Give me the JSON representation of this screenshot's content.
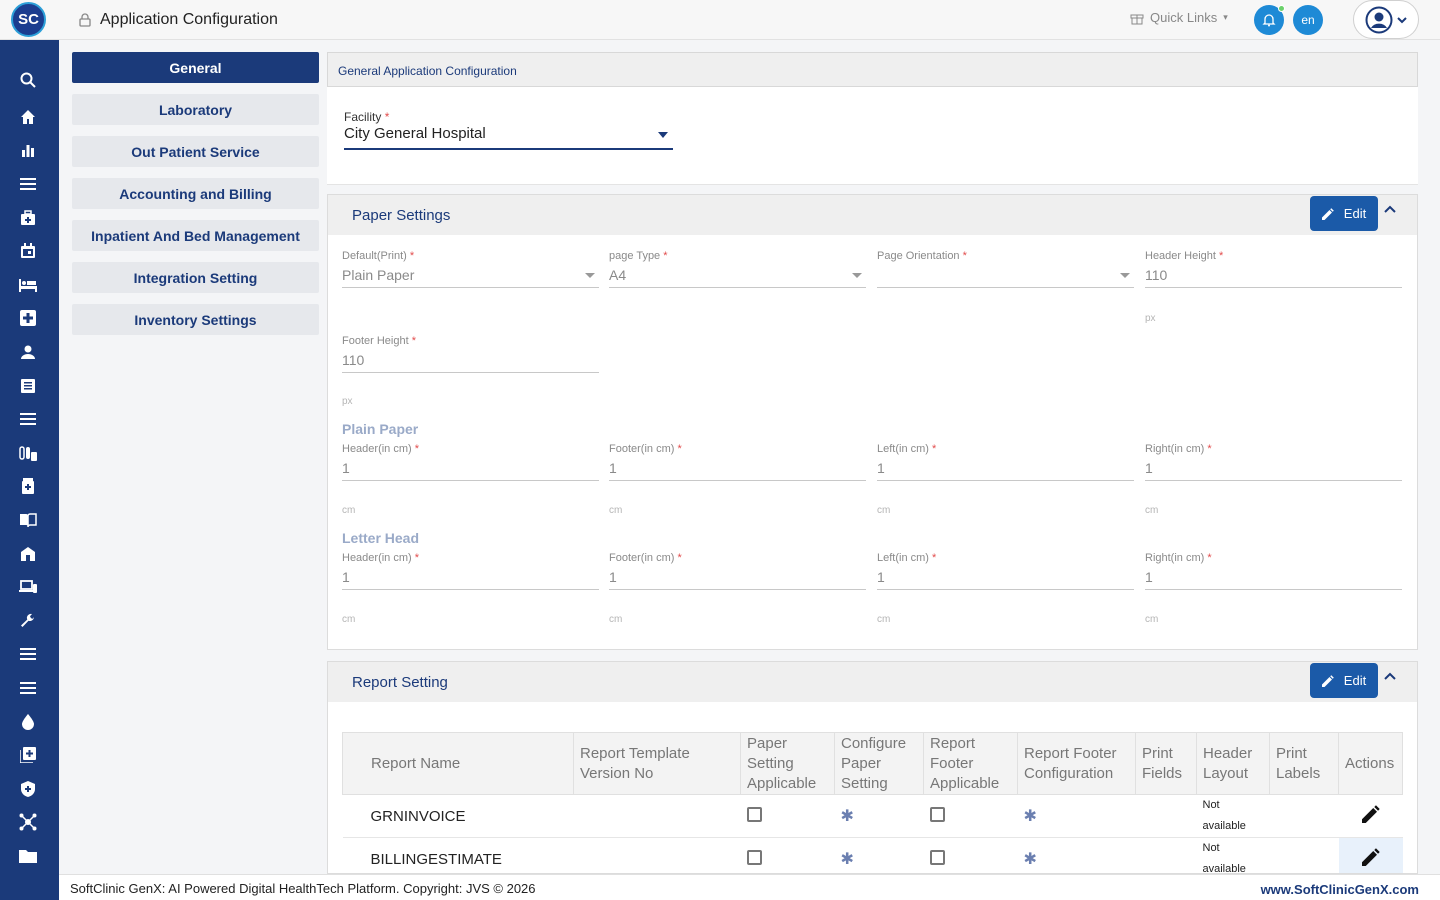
{
  "app": {
    "logo_text": "SC",
    "title": "Application Configuration",
    "quick_links": "Quick Links",
    "lang": "en"
  },
  "left_nav": [
    {
      "label": "General",
      "active": true
    },
    {
      "label": "Laboratory"
    },
    {
      "label": "Out Patient Service"
    },
    {
      "label": "Accounting and Billing"
    },
    {
      "label": "Inpatient And Bed Management"
    },
    {
      "label": "Integration Setting"
    },
    {
      "label": "Inventory Settings"
    }
  ],
  "main": {
    "header": "General Application Configuration",
    "facility": {
      "label": "Facility",
      "required": "*",
      "value": "City General Hospital"
    }
  },
  "paper_settings": {
    "title": "Paper Settings",
    "edit_label": "Edit",
    "default_print": {
      "label": "Default(Print)",
      "value": "Plain Paper"
    },
    "page_type": {
      "label": "page Type",
      "value": "A4"
    },
    "page_orientation": {
      "label": "Page Orientation",
      "value": ""
    },
    "header_height": {
      "label": "Header Height",
      "value": "110",
      "unit": "px"
    },
    "footer_height": {
      "label": "Footer Height",
      "value": "110",
      "unit": "px"
    },
    "plain_paper": {
      "title": "Plain Paper",
      "header": {
        "label": "Header(in cm)",
        "value": "1",
        "unit": "cm"
      },
      "footer": {
        "label": "Footer(in cm)",
        "value": "1",
        "unit": "cm"
      },
      "left": {
        "label": "Left(in cm)",
        "value": "1",
        "unit": "cm"
      },
      "right": {
        "label": "Right(in cm)",
        "value": "1",
        "unit": "cm"
      }
    },
    "letter_head": {
      "title": "Letter Head",
      "header": {
        "label": "Header(in cm)",
        "value": "1",
        "unit": "cm"
      },
      "footer": {
        "label": "Footer(in cm)",
        "value": "1",
        "unit": "cm"
      },
      "left": {
        "label": "Left(in cm)",
        "value": "1",
        "unit": "cm"
      },
      "right": {
        "label": "Right(in cm)",
        "value": "1",
        "unit": "cm"
      }
    }
  },
  "report_setting": {
    "title": "Report Setting",
    "edit_label": "Edit",
    "columns": {
      "report_name": "Report Name",
      "template_version_1": "Report Template",
      "template_version_2": "Version No",
      "paper_setting_1": "Paper",
      "paper_setting_2": "Setting",
      "paper_setting_3": "Applicable",
      "configure_paper_1": "Configure",
      "configure_paper_2": "Paper",
      "configure_paper_3": "Setting",
      "report_footer_1": "Report",
      "report_footer_2": "Footer",
      "report_footer_3": "Applicable",
      "footer_config_1": "Report Footer",
      "footer_config_2": "Configuration",
      "print_fields_1": "Print",
      "print_fields_2": "Fields",
      "header_layout_1": "Header",
      "header_layout_2": "Layout",
      "print_labels_1": "Print",
      "print_labels_2": "Labels",
      "actions": "Actions"
    },
    "rows": [
      {
        "name": "GRNINVOICE",
        "header_layout_1": "Not",
        "header_layout_2": "available"
      },
      {
        "name": "BILLINGESTIMATE",
        "header_layout_1": "Not",
        "header_layout_2": "available"
      }
    ]
  },
  "footer": {
    "copyright": "SoftClinic GenX: AI Powered Digital HealthTech Platform. Copyright: JVS © 2026",
    "website": "www.SoftClinicGenX.com"
  },
  "colors": {
    "primary": "#1b3a7a",
    "accent": "#1e8ad6",
    "edit_button": "#1b5aa8"
  }
}
